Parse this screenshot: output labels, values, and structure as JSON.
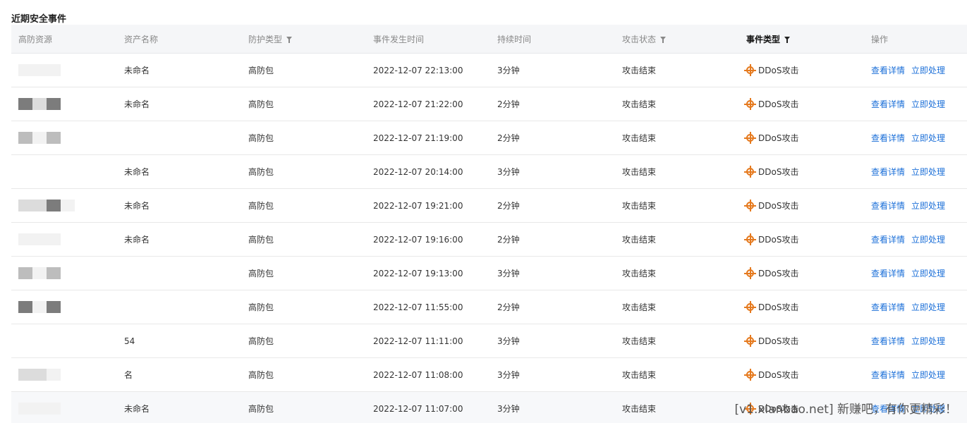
{
  "section": {
    "title": "近期安全事件"
  },
  "table": {
    "headers": [
      {
        "label": "高防资源",
        "filter": false,
        "active": false
      },
      {
        "label": "资产名称",
        "filter": false,
        "active": false
      },
      {
        "label": "防护类型",
        "filter": true,
        "active": false
      },
      {
        "label": "事件发生时间",
        "filter": false,
        "active": false
      },
      {
        "label": "持续时间",
        "filter": false,
        "active": false
      },
      {
        "label": "攻击状态",
        "filter": true,
        "active": false
      },
      {
        "label": "事件类型",
        "filter": true,
        "active": true
      },
      {
        "label": "操作",
        "filter": false,
        "active": false
      }
    ],
    "rows": [
      {
        "asset_name": "未命名",
        "protection": "高防包",
        "time": "2022-12-07 22:13:00",
        "duration": "3分钟",
        "status": "攻击结束",
        "event_type": "DDoS攻击"
      },
      {
        "asset_name": "未命名",
        "protection": "高防包",
        "time": "2022-12-07 21:22:00",
        "duration": "2分钟",
        "status": "攻击结束",
        "event_type": "DDoS攻击"
      },
      {
        "asset_name": "",
        "protection": "高防包",
        "time": "2022-12-07 21:19:00",
        "duration": "2分钟",
        "status": "攻击结束",
        "event_type": "DDoS攻击"
      },
      {
        "asset_name": "未命名",
        "protection": "高防包",
        "time": "2022-12-07 20:14:00",
        "duration": "3分钟",
        "status": "攻击结束",
        "event_type": "DDoS攻击"
      },
      {
        "asset_name": "未命名",
        "protection": "高防包",
        "time": "2022-12-07 19:21:00",
        "duration": "2分钟",
        "status": "攻击结束",
        "event_type": "DDoS攻击"
      },
      {
        "asset_name": "未命名",
        "protection": "高防包",
        "time": "2022-12-07 19:16:00",
        "duration": "2分钟",
        "status": "攻击结束",
        "event_type": "DDoS攻击"
      },
      {
        "asset_name": "",
        "protection": "高防包",
        "time": "2022-12-07 19:13:00",
        "duration": "3分钟",
        "status": "攻击结束",
        "event_type": "DDoS攻击"
      },
      {
        "asset_name": "",
        "protection": "高防包",
        "time": "2022-12-07 11:55:00",
        "duration": "2分钟",
        "status": "攻击结束",
        "event_type": "DDoS攻击"
      },
      {
        "asset_name": "54",
        "protection": "高防包",
        "time": "2022-12-07 11:11:00",
        "duration": "3分钟",
        "status": "攻击结束",
        "event_type": "DDoS攻击"
      },
      {
        "asset_name": "名",
        "protection": "高防包",
        "time": "2022-12-07 11:08:00",
        "duration": "3分钟",
        "status": "攻击结束",
        "event_type": "DDoS攻击"
      },
      {
        "asset_name": "未命名",
        "protection": "高防包",
        "time": "2022-12-07 11:07:00",
        "duration": "3分钟",
        "status": "攻击结束",
        "event_type": "DDoS攻击"
      }
    ],
    "actions": {
      "detail": "查看详情",
      "handle": "立即处理"
    }
  },
  "icons": {
    "event_type_icon": "crosshair-icon",
    "filter_icon": "filter-icon"
  },
  "colors": {
    "link": "#1b6fd8",
    "ddos_icon": "#e57a1f",
    "header_bg": "#f5f6f8"
  },
  "watermark": "[v1.xianbao.net] 新赚吧，有你更精彩！"
}
